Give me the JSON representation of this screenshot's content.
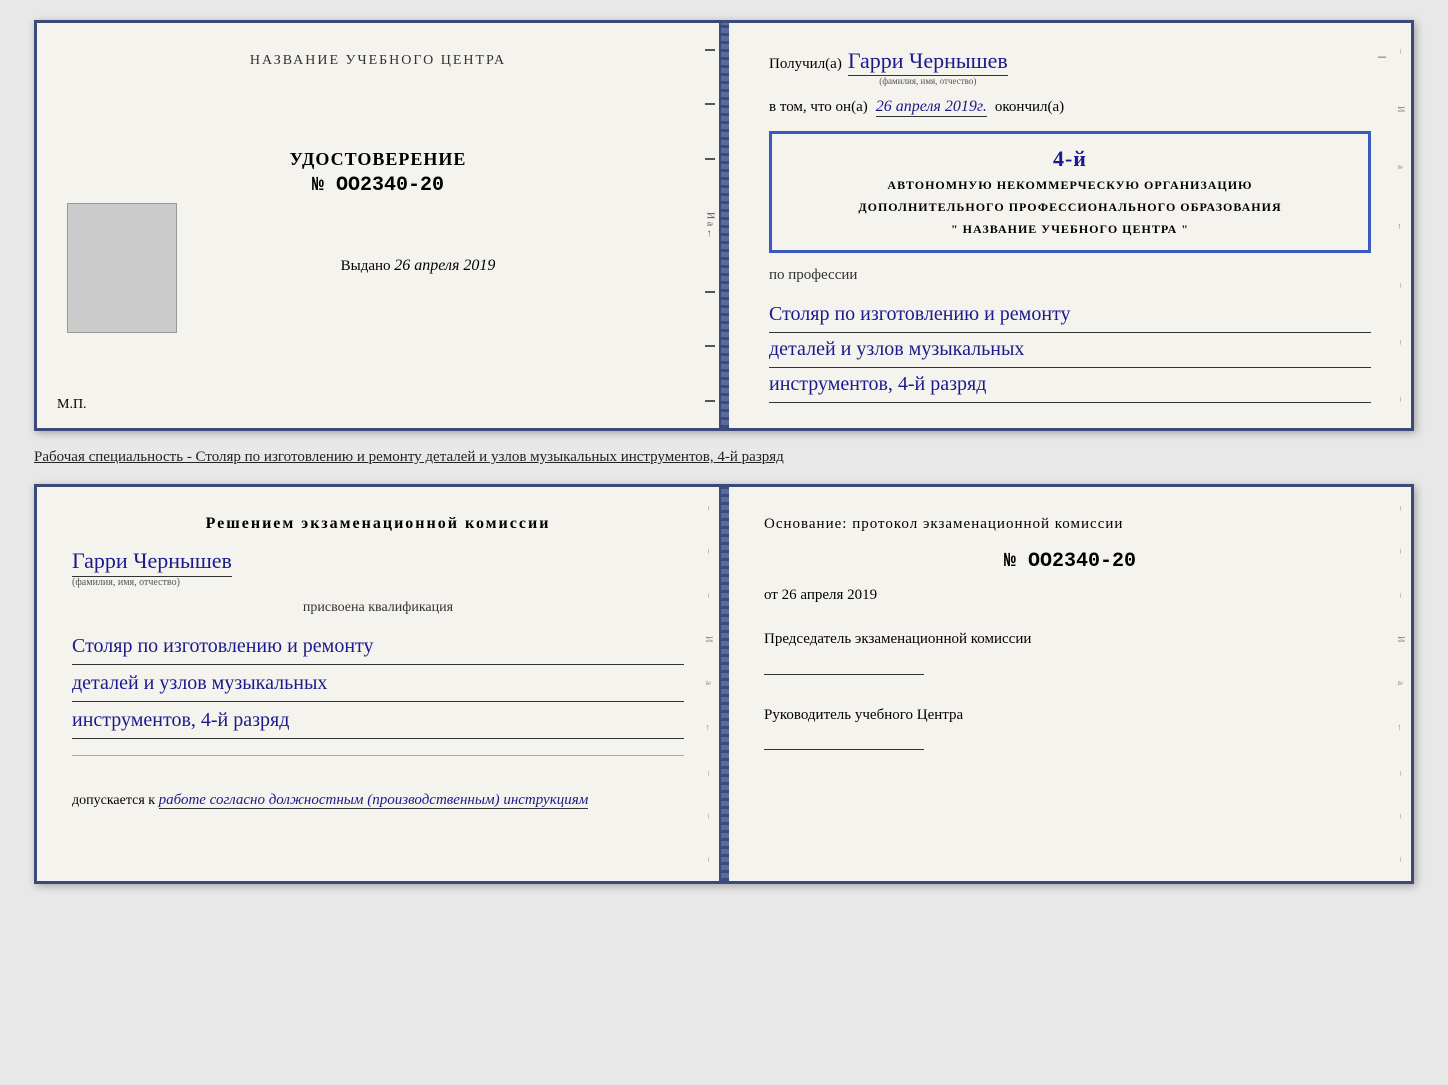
{
  "top_left": {
    "center_label": "НАЗВАНИЕ УЧЕБНОГО ЦЕНТРА",
    "udostoverenie": "УДОСТОВЕРЕНИЕ",
    "number": "№ OO2340-20",
    "vydano_label": "Выдано",
    "vydano_date": "26 апреля 2019",
    "mp_label": "М.П."
  },
  "top_right": {
    "poluchil_prefix": "Получил(а)",
    "name": "Гарри Чернышев",
    "name_sub": "(фамилия, имя, отчество)",
    "vtom_prefix": "в том, что он(а)",
    "date_hand": "26 апреля 2019г.",
    "okoncil": "окончил(а)",
    "stamp_line1": "4-й",
    "stamp_line2": "АВТОНОМНУЮ НЕКОММЕРЧЕСКУЮ ОРГАНИЗАЦИЮ",
    "stamp_line3": "ДОПОЛНИТЕЛЬНОГО ПРОФЕССИОНАЛЬНОГО ОБРАЗОВАНИЯ",
    "stamp_line4": "\" НАЗВАНИЕ УЧЕБНОГО ЦЕНТРА \"",
    "po_professii": "по профессии",
    "profession1": "Столяр по изготовлению и ремонту",
    "profession2": "деталей и узлов музыкальных",
    "profession3": "инструментов, 4-й разряд"
  },
  "caption": {
    "text": "Рабочая специальность - Столяр по изготовлению и ремонту деталей и узлов музыкальных инструментов, 4-й разряд"
  },
  "bottom_left": {
    "resheniem": "Решением  экзаменационной  комиссии",
    "name": "Гарри Чернышев",
    "name_sub": "(фамилия, имя, отчество)",
    "prisvoena": "присвоена квалификация",
    "qual1": "Столяр по изготовлению и ремонту",
    "qual2": "деталей и узлов музыкальных",
    "qual3": "инструментов, 4-й разряд",
    "dopusk_prefix": "допускается к",
    "dopusk_text": "работе согласно должностным (производственным) инструкциям"
  },
  "bottom_right": {
    "osnovanie": "Основание:  протокол  экзаменационной  комиссии",
    "number": "№  OO2340-20",
    "ot_prefix": "от",
    "ot_date": "26 апреля 2019",
    "predsedatel_title": "Председатель экзаменационной комиссии",
    "rukovoditel_title": "Руководитель учебного Центра"
  }
}
